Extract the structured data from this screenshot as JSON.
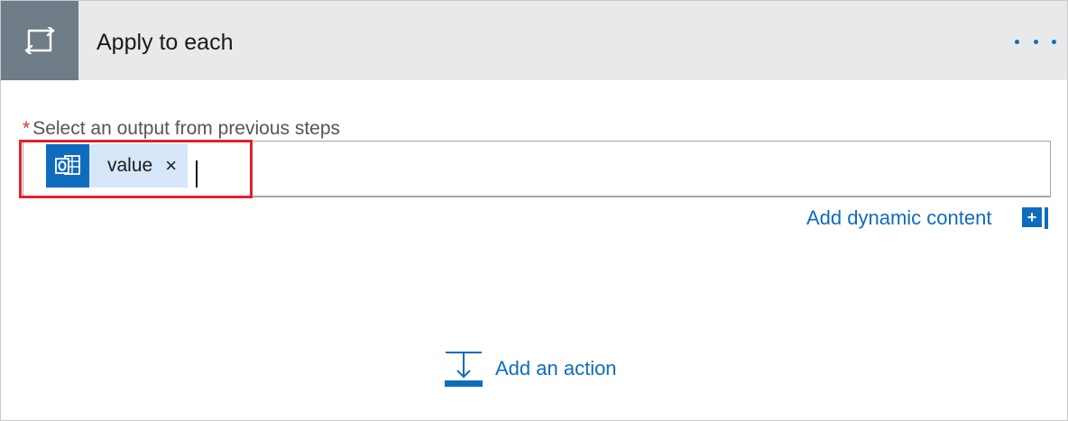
{
  "header": {
    "title": "Apply to each",
    "icon": "loop-icon",
    "more_icon": "more-options-icon"
  },
  "field": {
    "required_marker": "*",
    "label": "Select an output from previous steps",
    "token": {
      "icon": "outlook-icon",
      "label": "value",
      "remove_glyph": "×"
    }
  },
  "dynamic_content": {
    "link_text": "Add dynamic content",
    "button_glyph": "+"
  },
  "add_action": {
    "label": "Add an action",
    "icon": "add-action-icon"
  },
  "colors": {
    "accent": "#0f6cbd",
    "header_bg": "#e8e9eb",
    "header_icon_bg": "#6f7c88",
    "highlight": "#e3202e",
    "required": "#d13438"
  }
}
